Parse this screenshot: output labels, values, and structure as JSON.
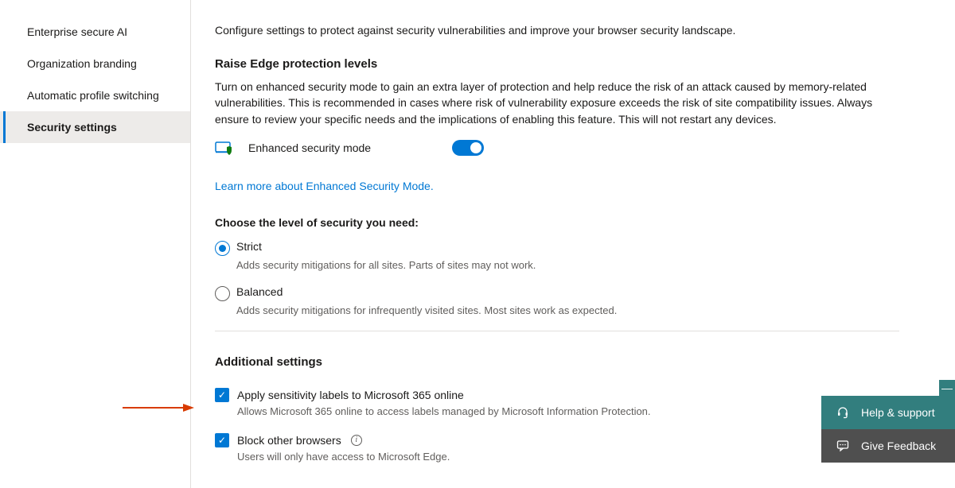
{
  "sidebar": {
    "items": [
      {
        "label": "Enterprise secure AI"
      },
      {
        "label": "Organization branding"
      },
      {
        "label": "Automatic profile switching"
      },
      {
        "label": "Security settings"
      }
    ]
  },
  "main": {
    "intro": "Configure settings to protect against security vulnerabilities and improve your browser security landscape.",
    "raise_title": "Raise Edge protection levels",
    "raise_desc": "Turn on enhanced security mode to gain an extra layer of protection and help reduce the risk of an attack caused by memory-related vulnerabilities. This is recommended in cases where risk of vulnerability exposure exceeds the risk of site compatibility issues. Always ensure to review your specific needs and the implications of enabling this feature. This will not restart any devices.",
    "toggle_label": "Enhanced security mode",
    "learn_link": "Learn more about Enhanced Security Mode.",
    "choose_title": "Choose the level of security you need:",
    "strict_label": "Strict",
    "strict_desc": "Adds security mitigations for all sites. Parts of sites may not work.",
    "balanced_label": "Balanced",
    "balanced_desc": "Adds security mitigations for infrequently visited sites. Most sites work as expected.",
    "additional_title": "Additional settings",
    "apply_label": "Apply sensitivity labels to Microsoft 365 online",
    "apply_desc": "Allows Microsoft 365 online to access labels managed by Microsoft Information Protection.",
    "block_label": "Block other browsers",
    "block_desc": "Users will only have access to Microsoft Edge."
  },
  "float": {
    "help": "Help & support",
    "feedback": "Give Feedback"
  }
}
